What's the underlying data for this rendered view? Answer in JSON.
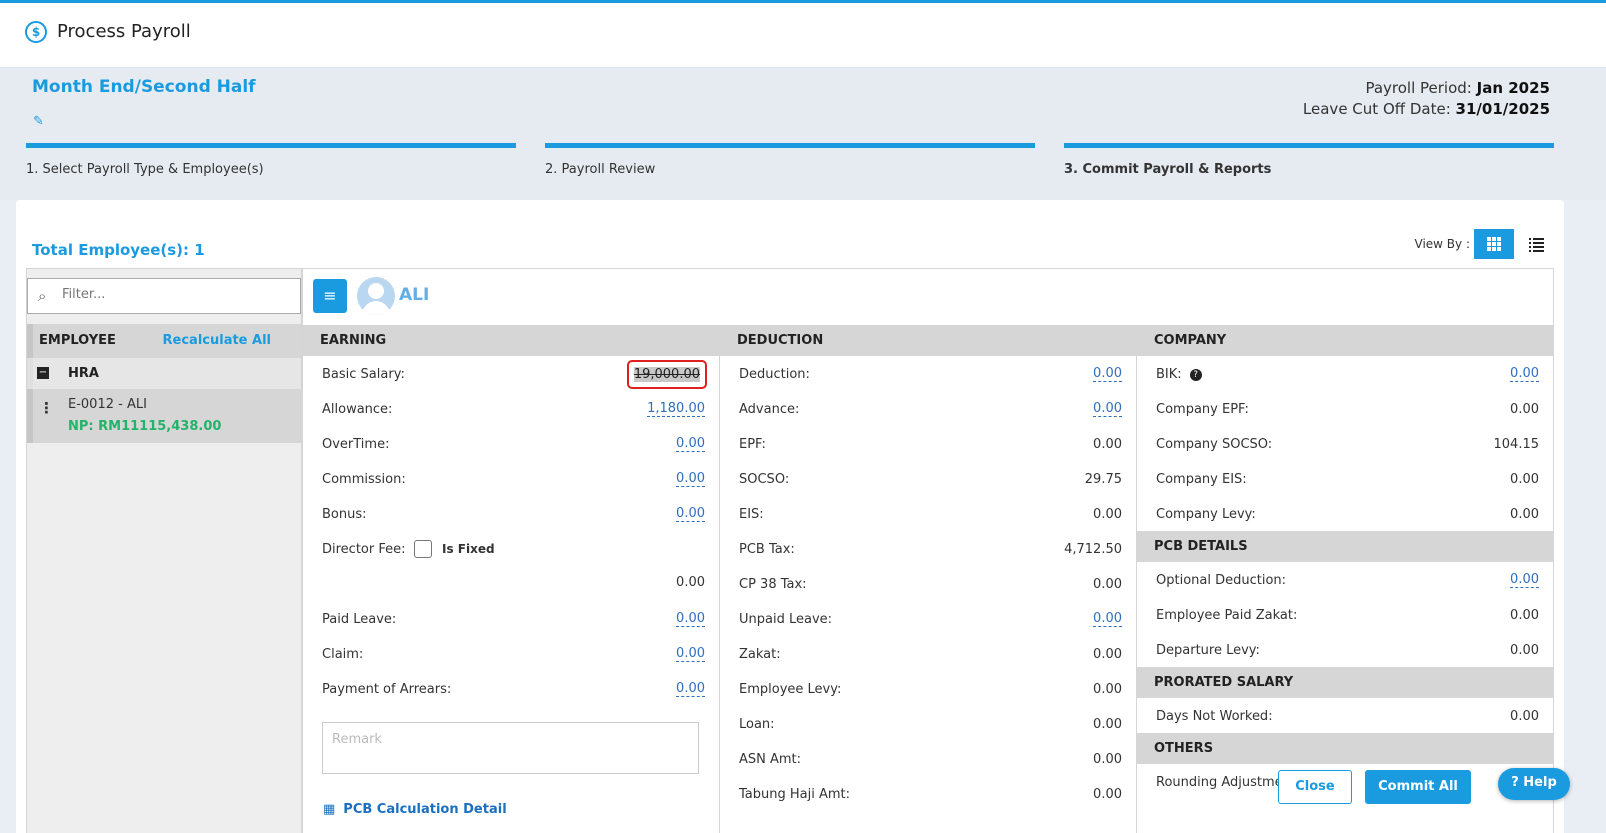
{
  "app": {
    "title": "Process Payroll",
    "logo_icon": "dollar-cycle-icon",
    "accent": "#1a9be0"
  },
  "header": {
    "payroll_type": "Month End/Second Half",
    "period_label": "Payroll Period:",
    "period_value": "Jan 2025",
    "cutoff_label": "Leave Cut Off Date:",
    "cutoff_value": "31/01/2025"
  },
  "steps": [
    {
      "label": "1. Select Payroll Type & Employee(s)",
      "active": false
    },
    {
      "label": "2. Payroll Review",
      "active": false
    },
    {
      "label": "3. Commit Payroll & Reports",
      "active": true
    }
  ],
  "summary": {
    "total_employees": "Total Employee(s): 1",
    "view_by": "View By :"
  },
  "left": {
    "filter_placeholder": "Filter...",
    "header": "EMPLOYEE",
    "recalc": "Recalculate All",
    "group": "HRA",
    "employee": "E-0012 - ALI",
    "net_pay": "NP: RM11115,438.00"
  },
  "employee_name": "ALI",
  "earning": {
    "title": "EARNING",
    "basic_salary": {
      "label": "Basic Salary:",
      "value": "19,000.00"
    },
    "allowance": {
      "label": "Allowance:",
      "value": "1,180.00"
    },
    "overtime": {
      "label": "OverTime:",
      "value": "0.00"
    },
    "commission": {
      "label": "Commission:",
      "value": "0.00"
    },
    "bonus": {
      "label": "Bonus:",
      "value": "0.00"
    },
    "director_fee": {
      "label": "Director Fee:",
      "fixed_label": "Is Fixed",
      "value": "0.00"
    },
    "paid_leave": {
      "label": "Paid Leave:",
      "value": "0.00"
    },
    "claim": {
      "label": "Claim:",
      "value": "0.00"
    },
    "arrears": {
      "label": "Payment of Arrears:",
      "value": "0.00"
    },
    "remark_placeholder": "Remark",
    "pcb_link": "PCB Calculation Detail"
  },
  "deduction": {
    "title": "DEDUCTION",
    "deduction": {
      "label": "Deduction:",
      "value": "0.00"
    },
    "advance": {
      "label": "Advance:",
      "value": "0.00"
    },
    "epf": {
      "label": "EPF:",
      "value": "0.00"
    },
    "socso": {
      "label": "SOCSO:",
      "value": "29.75"
    },
    "eis": {
      "label": "EIS:",
      "value": "0.00"
    },
    "pcb_tax": {
      "label": "PCB Tax:",
      "value": "4,712.50"
    },
    "cp38": {
      "label": "CP 38 Tax:",
      "value": "0.00"
    },
    "unpaid_leave": {
      "label": "Unpaid Leave:",
      "value": "0.00"
    },
    "zakat": {
      "label": "Zakat:",
      "value": "0.00"
    },
    "employee_levy": {
      "label": "Employee Levy:",
      "value": "0.00"
    },
    "loan": {
      "label": "Loan:",
      "value": "0.00"
    },
    "asn": {
      "label": "ASN Amt:",
      "value": "0.00"
    },
    "tabung_haji": {
      "label": "Tabung Haji Amt:",
      "value": "0.00"
    }
  },
  "company": {
    "title": "COMPANY",
    "bik": {
      "label": "BIK:",
      "value": "0.00"
    },
    "epf": {
      "label": "Company EPF:",
      "value": "0.00"
    },
    "socso": {
      "label": "Company SOCSO:",
      "value": "104.15"
    },
    "eis": {
      "label": "Company EIS:",
      "value": "0.00"
    },
    "levy": {
      "label": "Company Levy:",
      "value": "0.00"
    },
    "pcb_details_title": "PCB DETAILS",
    "optional_deduction": {
      "label": "Optional Deduction:",
      "value": "0.00"
    },
    "employee_zakat": {
      "label": "Employee Paid Zakat:",
      "value": "0.00"
    },
    "departure_levy": {
      "label": "Departure Levy:",
      "value": "0.00"
    },
    "prorated_title": "PRORATED SALARY",
    "days_not_worked": {
      "label": "Days Not Worked:",
      "value": "0.00"
    },
    "others_title": "OTHERS",
    "rounding": {
      "label": "Rounding Adjustment:"
    }
  },
  "footer": {
    "close": "Close",
    "commit": "Commit All",
    "help": "Help"
  }
}
